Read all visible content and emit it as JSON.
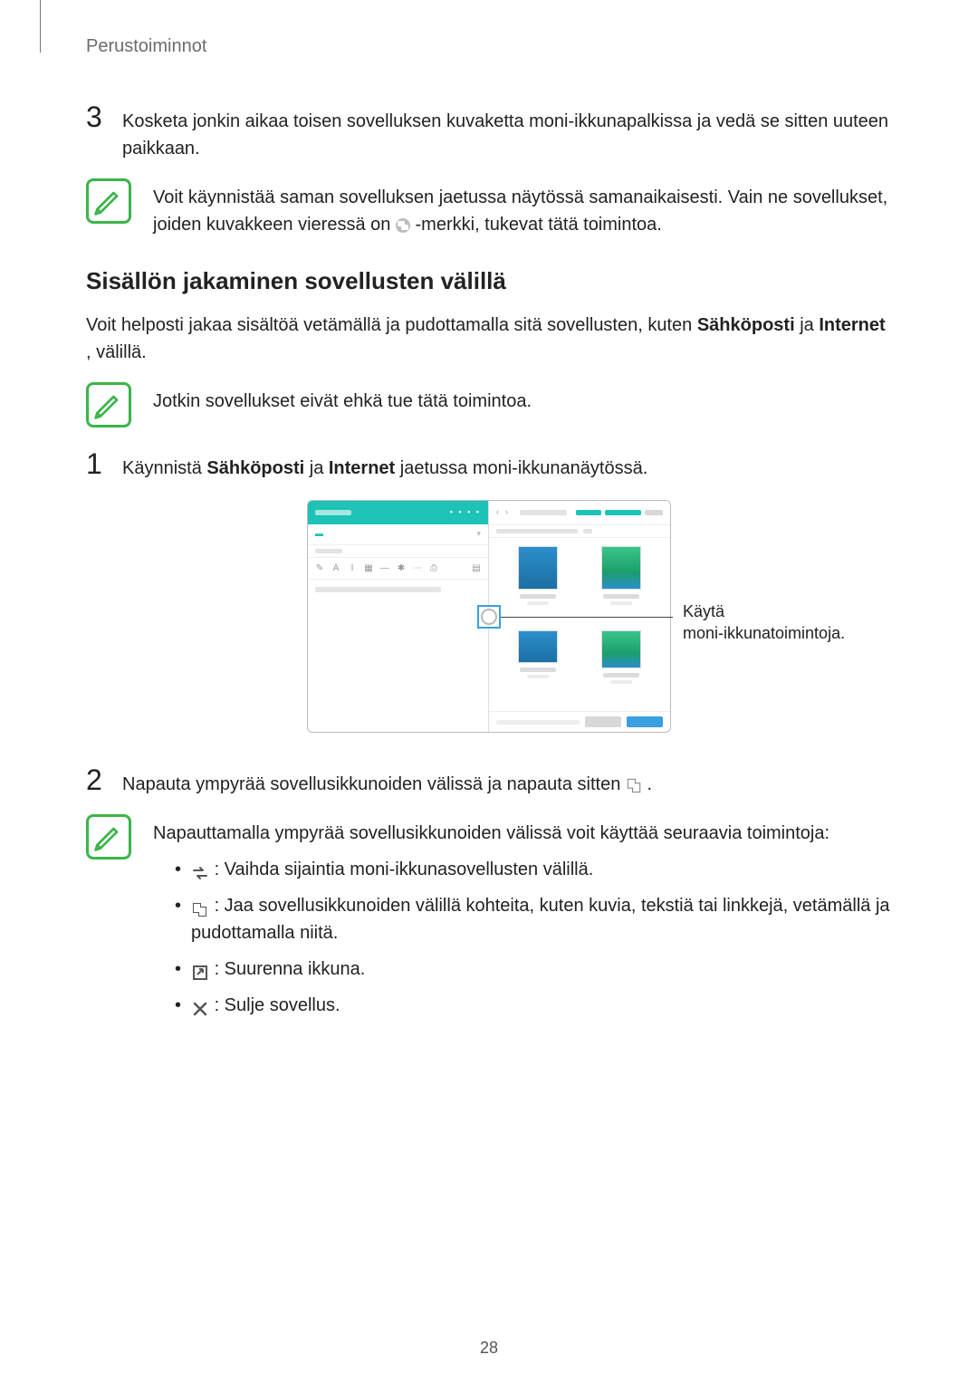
{
  "breadcrumb": "Perustoiminnot",
  "step3": {
    "number": "3",
    "text": "Kosketa jonkin aikaa toisen sovelluksen kuvaketta moni-ikkunapalkissa ja vedä se sitten uuteen paikkaan."
  },
  "note1_a": "Voit käynnistää saman sovelluksen jaetussa näytössä samanaikaisesti. Vain ne sovellukset, joiden kuvakkeen vieressä on ",
  "note1_b": "-merkki, tukevat tätä toimintoa.",
  "section_heading": "Sisällön jakaminen sovellusten välillä",
  "intro_a": "Voit helposti jakaa sisältöä vetämällä ja pudottamalla sitä sovellusten, kuten ",
  "intro_b": "Sähköposti",
  "intro_c": " ja ",
  "intro_d": "Internet",
  "intro_e": ", välillä.",
  "note2": "Jotkin sovellukset eivät ehkä tue tätä toimintoa.",
  "step1": {
    "number": "1",
    "pre": "Käynnistä ",
    "b1": "Sähköposti",
    "mid": " ja ",
    "b2": "Internet",
    "post": " jaetussa moni-ikkunanäytössä."
  },
  "callout_line1": "Käytä",
  "callout_line2": "moni-ikkunatoimintoja.",
  "step2": {
    "number": "2",
    "pre": "Napauta ympyrää sovellusikkunoiden välissä ja napauta sitten ",
    "post": "."
  },
  "note3_intro": "Napauttamalla ympyrää sovellusikkunoiden välissä voit käyttää seuraavia toimintoja:",
  "bullets": {
    "swap": " : Vaihda sijaintia moni-ikkunasovellusten välillä.",
    "share": " : Jaa sovellusikkunoiden välillä kohteita, kuten kuvia, tekstiä tai linkkejä, vetämällä ja pudottamalla niitä.",
    "max": " : Suurenna ikkuna.",
    "close": " : Sulje sovellus."
  },
  "page_number": "28"
}
